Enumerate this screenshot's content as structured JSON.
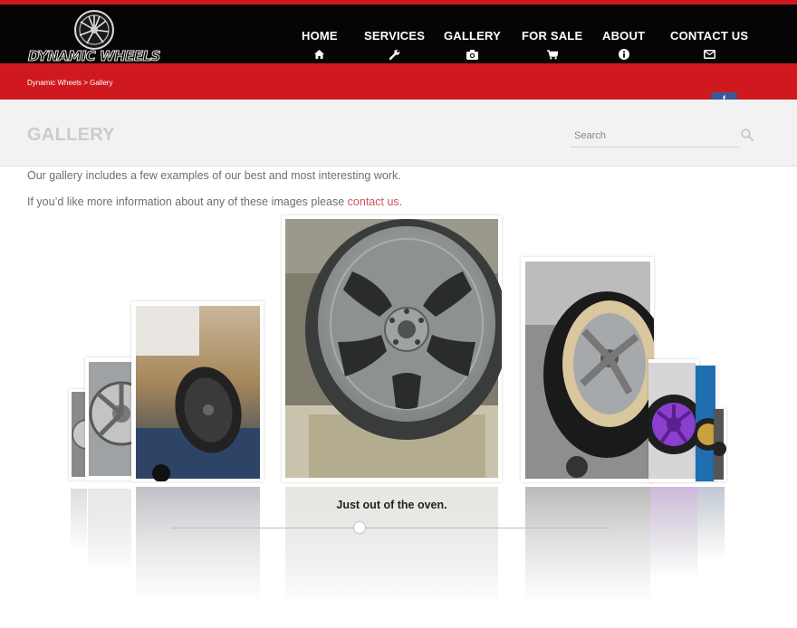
{
  "brand": {
    "logo_text": "DYNAMIC WHEELS",
    "accent": "#d0191f",
    "header_bg": "#050505"
  },
  "nav": [
    {
      "label": "HOME",
      "icon": "home-icon"
    },
    {
      "label": "SERVICES",
      "icon": "wrench-icon"
    },
    {
      "label": "GALLERY",
      "icon": "camera-icon"
    },
    {
      "label": "FOR SALE",
      "icon": "cart-icon"
    },
    {
      "label": "ABOUT",
      "icon": "info-icon"
    },
    {
      "label": "CONTACT US",
      "icon": "envelope-icon"
    }
  ],
  "breadcrumb": "Dynamic Wheels > Gallery",
  "social": {
    "label": "f"
  },
  "page": {
    "title": "GALLERY"
  },
  "search": {
    "placeholder": "Search",
    "icon": "search-icon"
  },
  "intro": {
    "line1": "Our gallery includes a few examples of our best and most interesting work.",
    "line2_before": "If you’d like more information about any of these images please ",
    "line2_link": "contact us",
    "line2_after": "."
  },
  "gallery": {
    "caption": "Just out of the oven.",
    "slide_count": 9,
    "active_index": 4
  }
}
